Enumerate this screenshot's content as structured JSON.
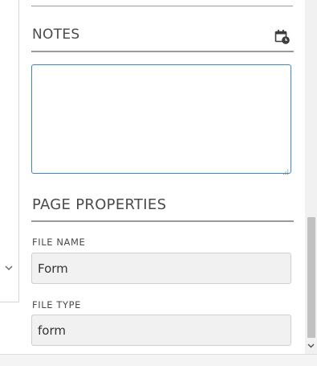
{
  "notes": {
    "title": "NOTES",
    "icon": "calendar-clock-icon",
    "value": ""
  },
  "page_properties": {
    "title": "PAGE PROPERTIES",
    "file_name": {
      "label": "FILE NAME",
      "value": "Form"
    },
    "file_type": {
      "label": "FILE TYPE",
      "value": "form"
    }
  },
  "colors": {
    "focus_border": "#3a86c8",
    "rule": "#9a9a9a",
    "field_bg": "#f1f1f1",
    "text": "#4a4a4a"
  }
}
